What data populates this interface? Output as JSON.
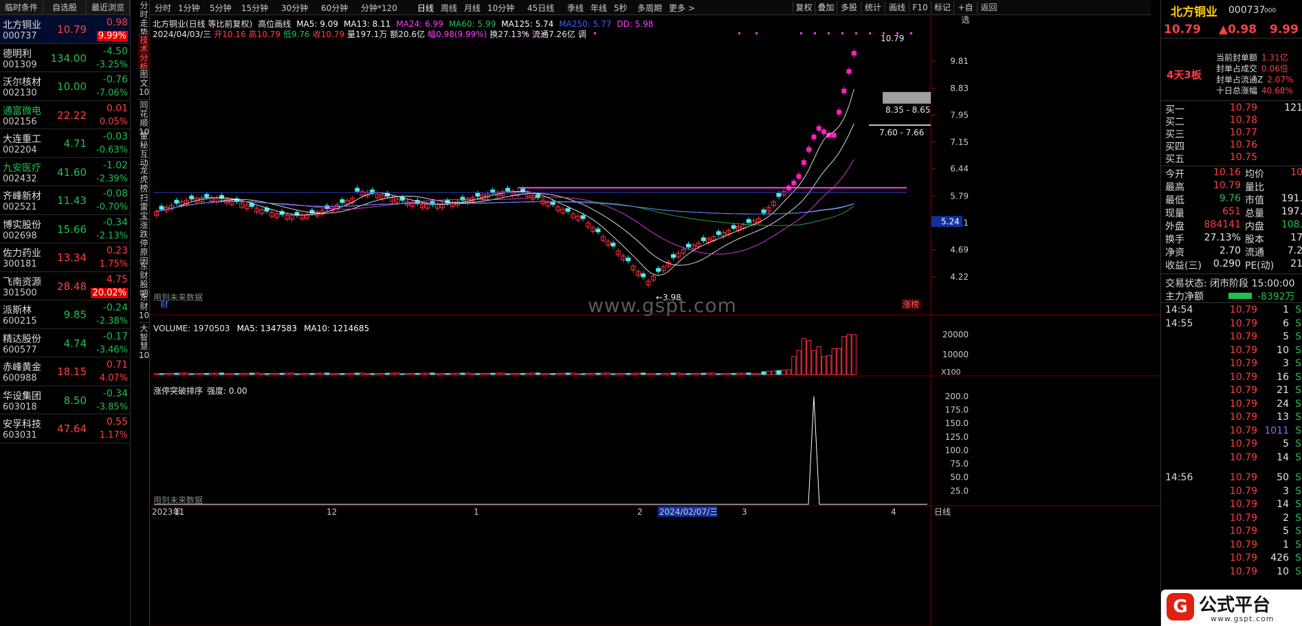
{
  "watchlist": {
    "tabs": [
      "临时条件",
      "自选股",
      "最近浏览"
    ],
    "rows": [
      {
        "name": "北方铜业",
        "code": "000737",
        "price": "10.79",
        "change": "0.98",
        "pct": "9.99%",
        "color": "up",
        "selected": true,
        "pct_highlight": true
      },
      {
        "name": "德明利",
        "code": "001309",
        "price": "134.00",
        "change": "-4.50",
        "pct": "-3.25%",
        "color": "dn"
      },
      {
        "name": "沃尔核材",
        "code": "002130",
        "price": "10.00",
        "change": "-0.76",
        "pct": "-7.06%",
        "color": "dn"
      },
      {
        "name": "通富微电",
        "code": "002156",
        "price": "22.22",
        "change": "0.01",
        "pct": "0.05%",
        "color": "up",
        "name_green": true
      },
      {
        "name": "大连重工",
        "code": "002204",
        "price": "4.71",
        "change": "-0.03",
        "pct": "-0.63%",
        "color": "dn"
      },
      {
        "name": "九安医疗",
        "code": "002432",
        "price": "41.60",
        "change": "-1.02",
        "pct": "-2.39%",
        "color": "dn",
        "name_green": true
      },
      {
        "name": "齐峰新材",
        "code": "002521",
        "price": "11.43",
        "change": "-0.08",
        "pct": "-0.70%",
        "color": "dn"
      },
      {
        "name": "博实股份",
        "code": "002698",
        "price": "15.66",
        "change": "-0.34",
        "pct": "-2.13%",
        "color": "dn"
      },
      {
        "name": "佐力药业",
        "code": "300181",
        "price": "13.34",
        "change": "0.23",
        "pct": "1.75%",
        "color": "up"
      },
      {
        "name": "飞南资源",
        "code": "301500",
        "price": "28.48",
        "change": "4.75",
        "pct": "20.02%",
        "color": "up",
        "pct_highlight": true
      },
      {
        "name": "派斯林",
        "code": "600215",
        "price": "9.85",
        "change": "-0.24",
        "pct": "-2.38%",
        "color": "dn"
      },
      {
        "name": "精达股份",
        "code": "600577",
        "price": "4.74",
        "change": "-0.17",
        "pct": "-3.46%",
        "color": "dn"
      },
      {
        "name": "赤峰黄金",
        "code": "600988",
        "price": "18.15",
        "change": "0.71",
        "pct": "4.07%",
        "color": "up"
      },
      {
        "name": "华设集团",
        "code": "603018",
        "price": "8.50",
        "change": "-0.34",
        "pct": "-3.85%",
        "color": "dn"
      },
      {
        "name": "安孚科技",
        "code": "603031",
        "price": "47.64",
        "change": "0.55",
        "pct": "1.17%",
        "color": "up"
      }
    ]
  },
  "side_tabs": [
    "分时走势",
    "技术分析",
    "图文10",
    "同花顺10",
    "董秘互动",
    "龙虎榜",
    "扫雷宝",
    "涨跌停原因",
    "东财股吧",
    "东财10",
    "大智慧10"
  ],
  "toolbar": {
    "periods": [
      "分时",
      "1分钟",
      "5分钟",
      "15分钟",
      "30分钟",
      "60分钟",
      "分钟*120",
      "日线",
      "周线",
      "月线",
      "10分钟",
      "45日线",
      "季线",
      "年线",
      "5秒",
      "多周期",
      "更多 >"
    ],
    "buttons": [
      "复权",
      "叠加",
      "多股",
      "统计",
      "画线",
      "F10",
      "标记",
      "+自选",
      "返回"
    ]
  },
  "chart": {
    "title": "北方铜业(日线 等比前复权)",
    "indicator_name": "高位画线",
    "ma_labels": [
      {
        "text": "MA5: 9.09",
        "color": "#ffffff"
      },
      {
        "text": "MA13: 8.11",
        "color": "#ffffff"
      },
      {
        "text": "MA24: 6.99",
        "color": "#ff40ff"
      },
      {
        "text": "MA60: 5.99",
        "color": "#20c050"
      },
      {
        "text": "MA125: 5.74",
        "color": "#ffffff"
      },
      {
        "text": "MA250: 5.77",
        "color": "#4060ff"
      },
      {
        "text": "DD: 5.98",
        "color": "#ff40ff"
      }
    ],
    "day_info": {
      "date": "2024/04/03/三",
      "open": "开10.16",
      "high": "高10.79",
      "low": "低9.76",
      "close": "收10.79",
      "volume": "量197.1万",
      "amount": "额20.6亿",
      "change": "幅0.98(9.99%)",
      "turnover": "换27.13%",
      "float": "流通7.26亿",
      "suffix": "调"
    },
    "y_ticks": [
      "9.81",
      "8.83",
      "7.95",
      "7.15",
      "6.44",
      "5.79",
      "5.21",
      "4.69",
      "4.22"
    ],
    "current_price_tag": "5.24",
    "annotations": {
      "high_label": "10.79",
      "low_label": "3.98",
      "range_a": "8.35 - 8.65",
      "range_b": "7.60 - 7.66",
      "no_future_1": "用到未来数据",
      "cai": "财",
      "limit_tag": "涨榜"
    },
    "watermark": "www.gspt.com",
    "volume_panel": {
      "label": "VOLUME: 1970503",
      "ma5": "MA5: 1347583",
      "ma10": "MA10: 1214685",
      "y_ticks": [
        "20000",
        "10000"
      ],
      "unit": "X100"
    },
    "indicator_panel": {
      "label": "涨停突破排序",
      "strength": "强度: 0.00",
      "y_ticks": [
        "200.0",
        "175.0",
        "150.0",
        "125.0",
        "100.0",
        "75.0",
        "50.0",
        "25.0"
      ],
      "no_future_2": "用到未来数据"
    },
    "x_axis": {
      "labels": [
        "2023年",
        "11",
        "12",
        "1",
        "2",
        "2024/02/07/三",
        "3",
        "4"
      ],
      "period": "日线"
    }
  },
  "right_panel": {
    "name": "北方铜业",
    "code": "000737",
    "code_suffix": "000",
    "price": "10.79",
    "change": "▲0.98",
    "pct": "9.99",
    "streak": "4天3板",
    "seal_info": [
      {
        "label": "当前封单额",
        "value": "1.31亿"
      },
      {
        "label": "封单占成交",
        "value": "0.06倍"
      },
      {
        "label": "封单占流通Z",
        "value": "2.07%"
      },
      {
        "label": "十日总涨幅",
        "value": "40.68%"
      }
    ],
    "orderbook": [
      {
        "label": "买一",
        "price": "10.79",
        "vol": "121"
      },
      {
        "label": "买二",
        "price": "10.78",
        "vol": ""
      },
      {
        "label": "买三",
        "price": "10.77",
        "vol": ""
      },
      {
        "label": "买四",
        "price": "10.76",
        "vol": ""
      },
      {
        "label": "买五",
        "price": "10.75",
        "vol": ""
      }
    ],
    "stats": [
      {
        "l1": "今开",
        "v1": "10.16",
        "l2": "均价",
        "v2": "10"
      },
      {
        "l1": "最高",
        "v1": "10.79",
        "l2": "量比",
        "v2": ""
      },
      {
        "l1": "最低",
        "v1": "9.76",
        "l2": "市值",
        "v2": "191."
      },
      {
        "l1": "现量",
        "v1": "651",
        "l2": "总量",
        "v2": "197."
      },
      {
        "l1": "外盘",
        "v1": "884141",
        "l2": "内盘",
        "v2": "108."
      },
      {
        "l1": "换手",
        "v1": "27.13%",
        "l2": "股本",
        "v2": "17"
      },
      {
        "l1": "净资",
        "v1": "2.70",
        "l2": "流通",
        "v2": "7.2"
      },
      {
        "l1": "收益(三)",
        "v1": "0.290",
        "l2": "PE(动)",
        "v2": "21"
      }
    ],
    "trade_status": "交易状态: 闭市阶段 15:00:00",
    "main_flow_label": "主力净额",
    "main_flow_value": "-8392万",
    "ticks": [
      {
        "time": "14:54",
        "price": "10.79",
        "vol": "1",
        "dir": "S"
      },
      {
        "time": "14:55",
        "price": "10.79",
        "vol": "6",
        "dir": "S"
      },
      {
        "time": "",
        "price": "10.79",
        "vol": "5",
        "dir": "S"
      },
      {
        "time": "",
        "price": "10.79",
        "vol": "10",
        "dir": "S"
      },
      {
        "time": "",
        "price": "10.79",
        "vol": "3",
        "dir": "S"
      },
      {
        "time": "",
        "price": "10.79",
        "vol": "16",
        "dir": "S"
      },
      {
        "time": "",
        "price": "10.79",
        "vol": "21",
        "dir": "S"
      },
      {
        "time": "",
        "price": "10.79",
        "vol": "24",
        "dir": "S"
      },
      {
        "time": "",
        "price": "10.79",
        "vol": "13",
        "dir": "S"
      },
      {
        "time": "",
        "price": "10.79",
        "vol": "1011",
        "dir": "S",
        "vol_blue": true
      },
      {
        "time": "",
        "price": "10.79",
        "vol": "5",
        "dir": "S"
      },
      {
        "time": "",
        "price": "10.79",
        "vol": "14",
        "dir": "S"
      },
      {
        "time": "14:56",
        "price": "10.79",
        "vol": "50",
        "dir": "S"
      },
      {
        "time": "",
        "price": "10.79",
        "vol": "3",
        "dir": "S"
      },
      {
        "time": "",
        "price": "10.79",
        "vol": "14",
        "dir": "S"
      },
      {
        "time": "",
        "price": "10.79",
        "vol": "2",
        "dir": "S"
      },
      {
        "time": "",
        "price": "10.79",
        "vol": "5",
        "dir": "S"
      },
      {
        "time": "",
        "price": "10.79",
        "vol": "1",
        "dir": "S"
      },
      {
        "time": "",
        "price": "10.79",
        "vol": "426",
        "dir": "S"
      },
      {
        "time": "",
        "price": "10.79",
        "vol": "10",
        "dir": "S"
      }
    ]
  },
  "badge": {
    "brand": "公式平台",
    "site": "www.gspt.com"
  }
}
